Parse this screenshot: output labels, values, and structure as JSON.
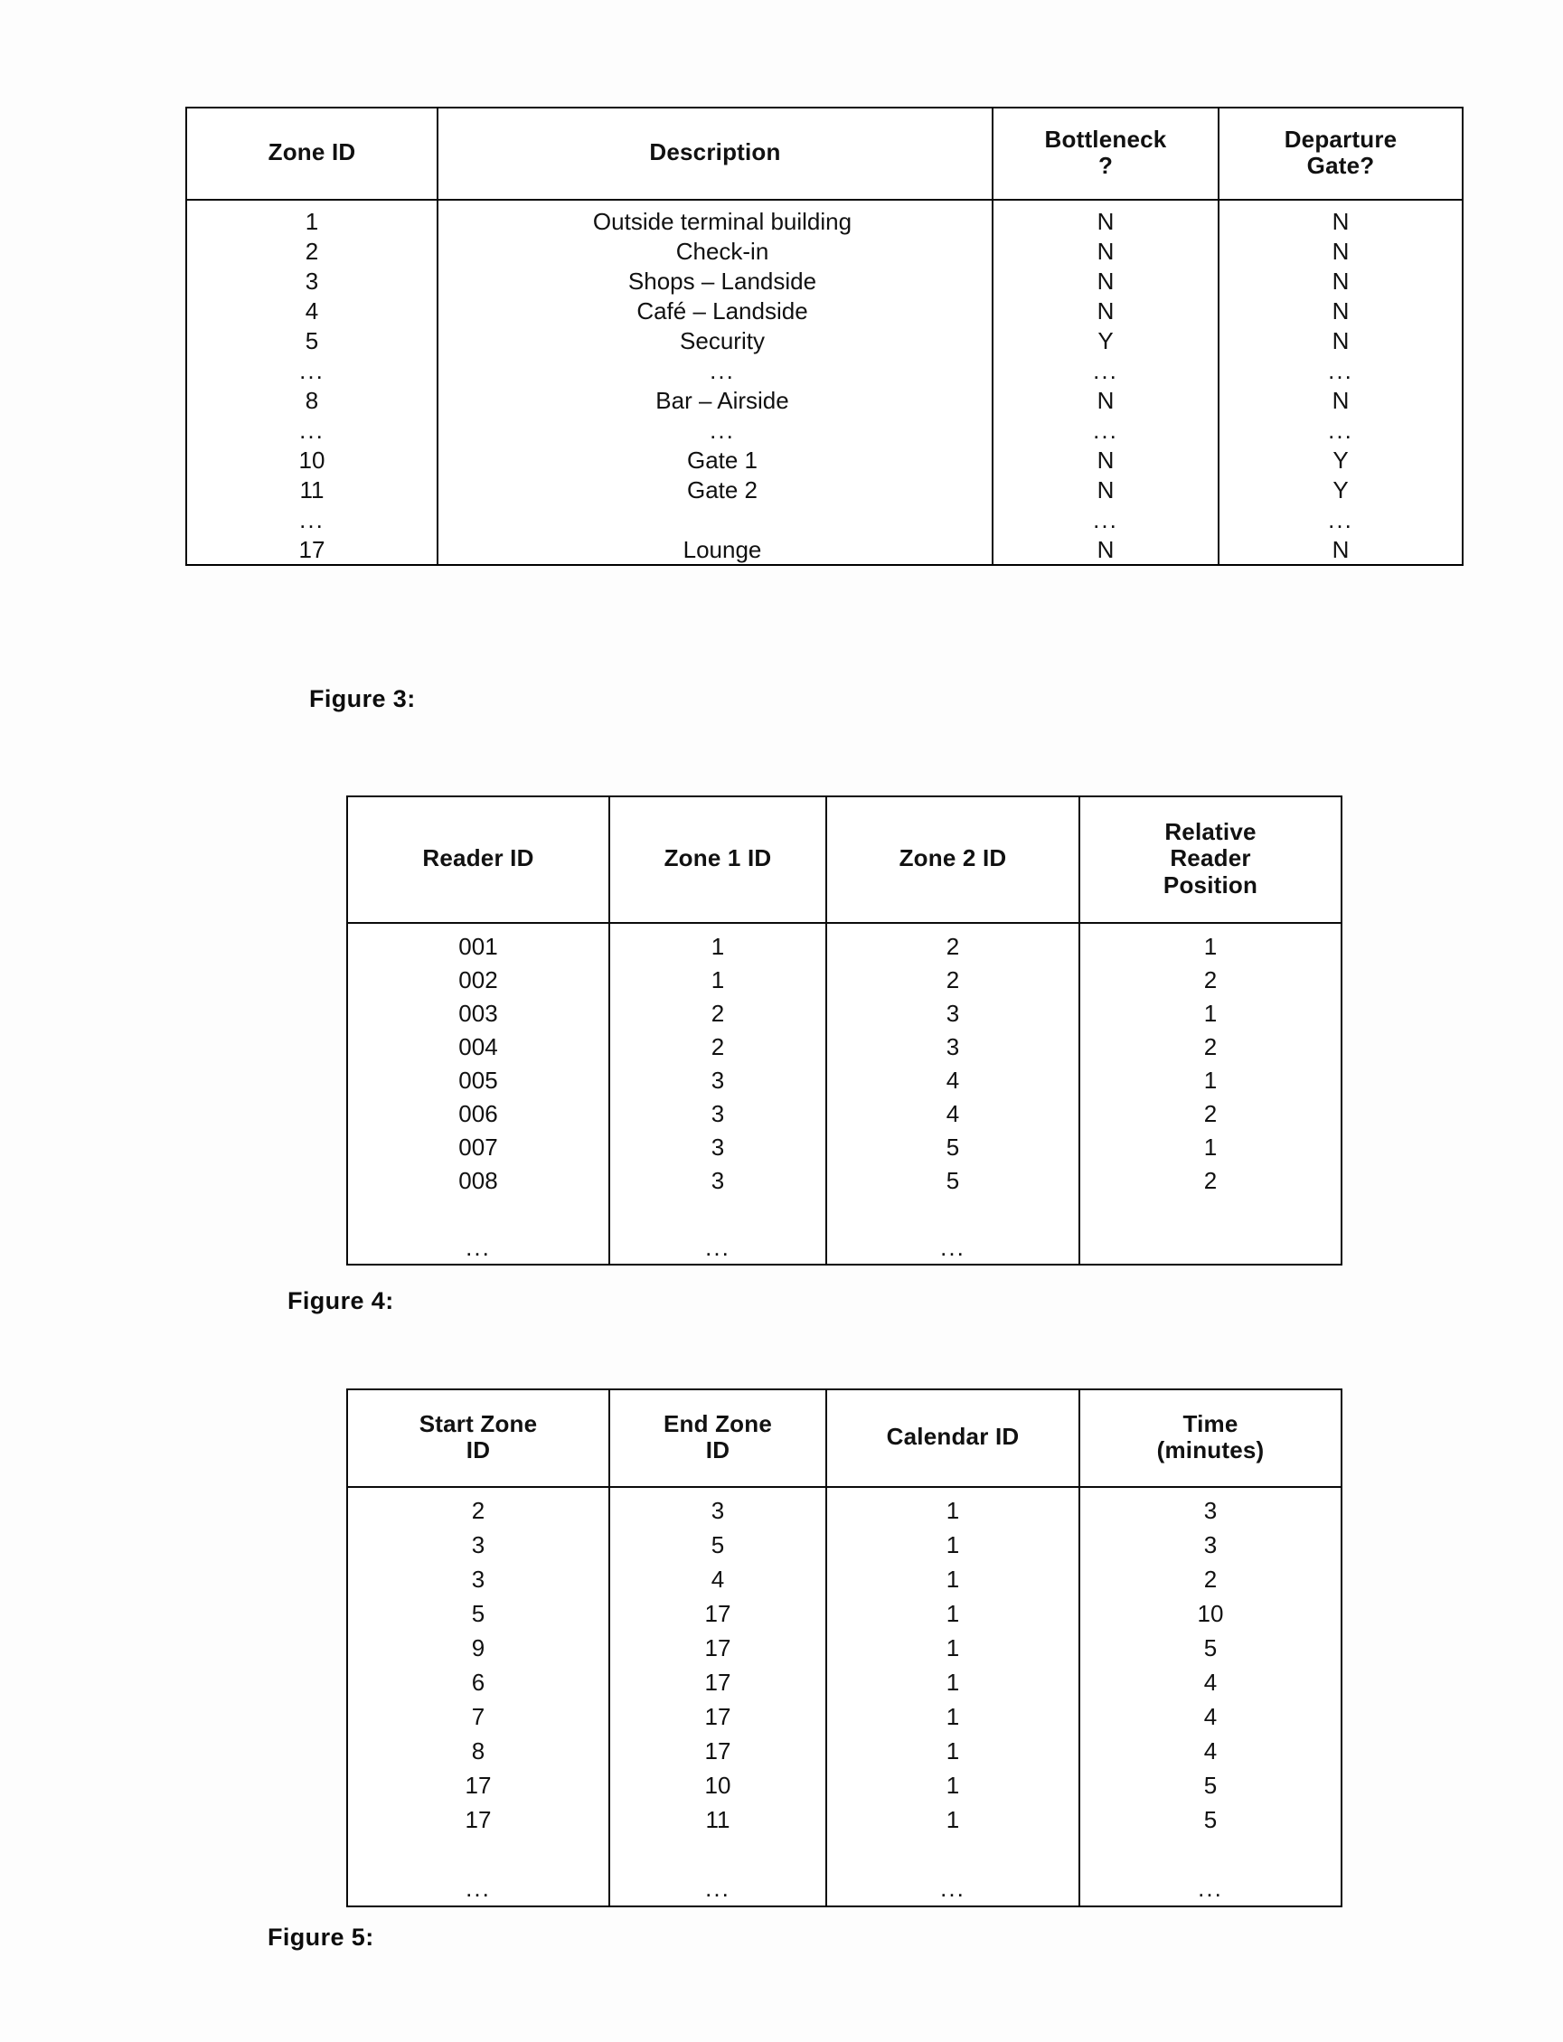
{
  "document": {
    "type": "patent-figure-page",
    "ink_color": "#0d0d0d",
    "paper_color": "#fdfdfd"
  },
  "figure3": {
    "caption": "Figure 3:",
    "table": {
      "columns": [
        "Zone ID",
        "Description",
        "Bottleneck ?",
        "Departure Gate?"
      ],
      "column_labels": {
        "zone_id": "Zone ID",
        "description": "Description",
        "bottleneck_line1": "Bottleneck",
        "bottleneck_line2": "?",
        "gate_line1": "Departure",
        "gate_line2": "Gate?"
      },
      "rows": [
        {
          "zone_id": "1",
          "description": "Outside terminal building",
          "bottleneck": "N",
          "departure_gate": "N"
        },
        {
          "zone_id": "2",
          "description": "Check-in",
          "bottleneck": "N",
          "departure_gate": "N"
        },
        {
          "zone_id": "3",
          "description": "Shops – Landside",
          "bottleneck": "N",
          "departure_gate": "N"
        },
        {
          "zone_id": "4",
          "description": "Café – Landside",
          "bottleneck": "N",
          "departure_gate": "N"
        },
        {
          "zone_id": "5",
          "description": "Security",
          "bottleneck": "Y",
          "departure_gate": "N"
        },
        {
          "zone_id": "...",
          "description": "...",
          "bottleneck": "...",
          "departure_gate": "..."
        },
        {
          "zone_id": "8",
          "description": "Bar – Airside",
          "bottleneck": "N",
          "departure_gate": "N"
        },
        {
          "zone_id": "...",
          "description": "...",
          "bottleneck": "...",
          "departure_gate": "..."
        },
        {
          "zone_id": "10",
          "description": "Gate 1",
          "bottleneck": "N",
          "departure_gate": "Y"
        },
        {
          "zone_id": "11",
          "description": "Gate 2",
          "bottleneck": "N",
          "departure_gate": "Y"
        },
        {
          "zone_id": "...",
          "description": "",
          "bottleneck": "...",
          "departure_gate": "..."
        },
        {
          "zone_id": "17",
          "description": "Lounge",
          "bottleneck": "N",
          "departure_gate": "N"
        }
      ]
    }
  },
  "figure4": {
    "caption": "Figure 4:",
    "table": {
      "columns": [
        "Reader ID",
        "Zone 1 ID",
        "Zone 2 ID",
        "Relative Reader Position"
      ],
      "column_labels": {
        "reader_id": "Reader ID",
        "zone1_id": "Zone 1 ID",
        "zone2_id": "Zone 2 ID",
        "rrp_line1": "Relative",
        "rrp_line2": "Reader",
        "rrp_line3": "Position"
      },
      "rows": [
        {
          "reader_id": "001",
          "zone1": "1",
          "zone2": "2",
          "position": "1"
        },
        {
          "reader_id": "002",
          "zone1": "1",
          "zone2": "2",
          "position": "2"
        },
        {
          "reader_id": "003",
          "zone1": "2",
          "zone2": "3",
          "position": "1"
        },
        {
          "reader_id": "004",
          "zone1": "2",
          "zone2": "3",
          "position": "2"
        },
        {
          "reader_id": "005",
          "zone1": "3",
          "zone2": "4",
          "position": "1"
        },
        {
          "reader_id": "006",
          "zone1": "3",
          "zone2": "4",
          "position": "2"
        },
        {
          "reader_id": "007",
          "zone1": "3",
          "zone2": "5",
          "position": "1"
        },
        {
          "reader_id": "008",
          "zone1": "3",
          "zone2": "5",
          "position": "2"
        },
        {
          "reader_id": "...",
          "zone1": "...",
          "zone2": "...",
          "position": ""
        }
      ]
    }
  },
  "figure5": {
    "caption": "Figure 5:",
    "table": {
      "columns": [
        "Start Zone ID",
        "End Zone ID",
        "Calendar ID",
        "Time (minutes)"
      ],
      "column_labels": {
        "start_line1": "Start Zone",
        "start_line2": "ID",
        "end_line1": "End Zone",
        "end_line2": "ID",
        "calendar_id": "Calendar ID",
        "time_line1": "Time",
        "time_line2": "(minutes)"
      },
      "rows": [
        {
          "start_zone": "2",
          "end_zone": "3",
          "calendar_id": "1",
          "time": "3"
        },
        {
          "start_zone": "3",
          "end_zone": "5",
          "calendar_id": "1",
          "time": "3"
        },
        {
          "start_zone": "3",
          "end_zone": "4",
          "calendar_id": "1",
          "time": "2"
        },
        {
          "start_zone": "5",
          "end_zone": "17",
          "calendar_id": "1",
          "time": "10"
        },
        {
          "start_zone": "9",
          "end_zone": "17",
          "calendar_id": "1",
          "time": "5"
        },
        {
          "start_zone": "6",
          "end_zone": "17",
          "calendar_id": "1",
          "time": "4"
        },
        {
          "start_zone": "7",
          "end_zone": "17",
          "calendar_id": "1",
          "time": "4"
        },
        {
          "start_zone": "8",
          "end_zone": "17",
          "calendar_id": "1",
          "time": "4"
        },
        {
          "start_zone": "17",
          "end_zone": "10",
          "calendar_id": "1",
          "time": "5"
        },
        {
          "start_zone": "17",
          "end_zone": "11",
          "calendar_id": "1",
          "time": "5"
        },
        {
          "start_zone": "...",
          "end_zone": "...",
          "calendar_id": "...",
          "time": "..."
        }
      ]
    }
  }
}
